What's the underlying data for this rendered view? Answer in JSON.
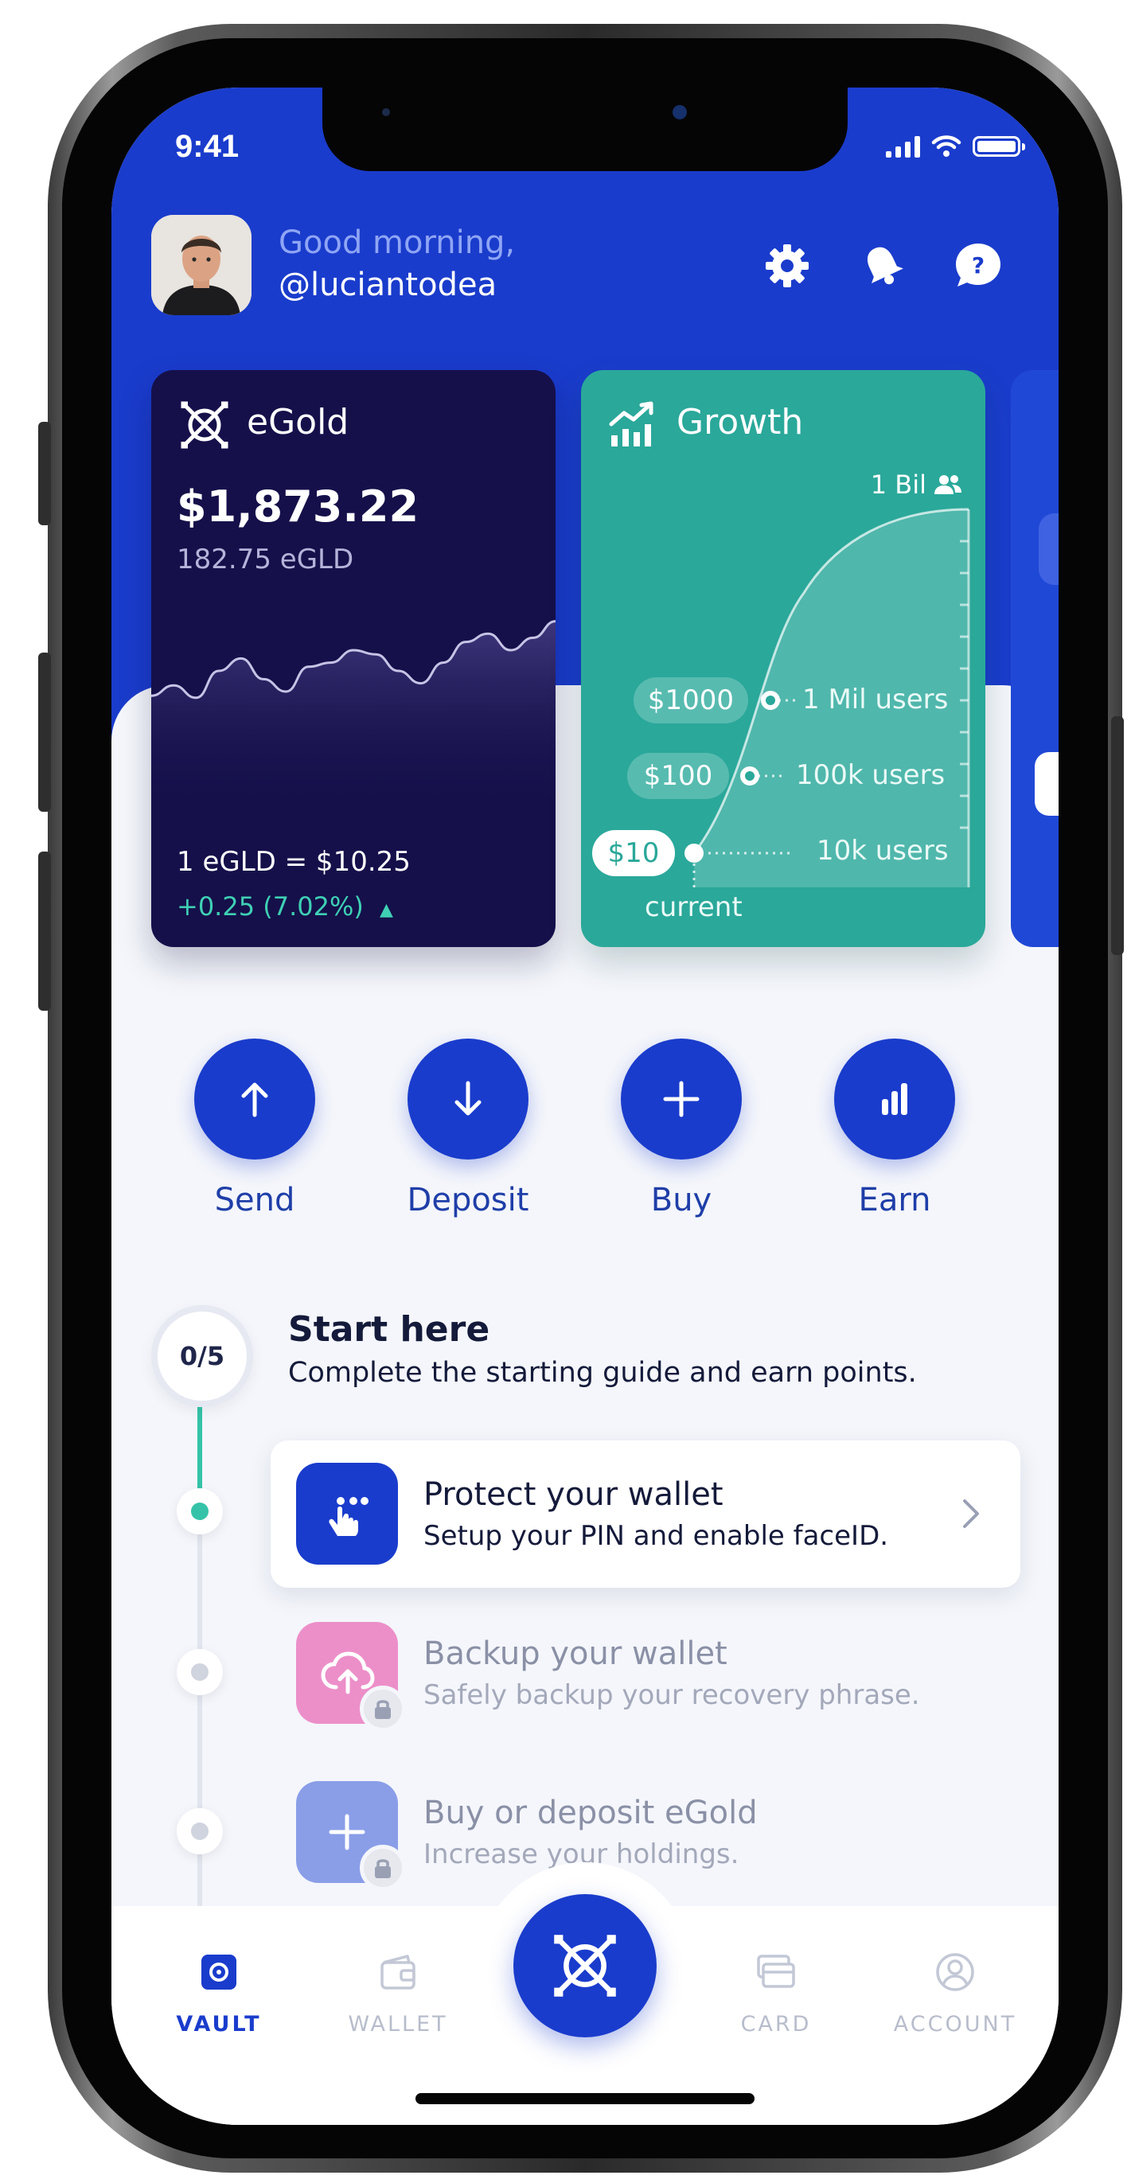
{
  "status": {
    "time": "9:41"
  },
  "header": {
    "greeting": "Good morning,",
    "username": "@luciantodea"
  },
  "cards": {
    "egold": {
      "title": "eGold",
      "amount": "$1,873.22",
      "sub": "182.75 eGLD",
      "rate": "1 eGLD = $10.25",
      "change": "+0.25 (7.02%)",
      "change_color": "#3fd0b4",
      "sparkline": [
        0.58,
        0.63,
        0.57,
        0.7,
        0.76,
        0.66,
        0.6,
        0.72,
        0.74,
        0.8,
        0.78,
        0.7,
        0.64,
        0.74,
        0.84,
        0.88,
        0.8,
        0.86,
        0.94
      ]
    },
    "growth": {
      "title": "Growth",
      "top_label": "1 Bil",
      "milestones": [
        {
          "price": "$1000",
          "users": "1 Mil users"
        },
        {
          "price": "$100",
          "users": "100k users"
        },
        {
          "price": "$10",
          "users": "10k users"
        }
      ],
      "current_label": "current"
    }
  },
  "actions": [
    {
      "label": "Send",
      "icon": "arrow-up-icon"
    },
    {
      "label": "Deposit",
      "icon": "arrow-down-icon"
    },
    {
      "label": "Buy",
      "icon": "plus-icon"
    },
    {
      "label": "Earn",
      "icon": "bar-chart-icon"
    }
  ],
  "guide": {
    "progress": "0/5",
    "title": "Start here",
    "subtitle": "Complete the starting guide and earn points.",
    "tasks": [
      {
        "title": "Protect your wallet",
        "sub": "Setup your PIN and enable faceID.",
        "locked": false
      },
      {
        "title": "Backup your wallet",
        "sub": "Safely backup your recovery phrase.",
        "locked": true
      },
      {
        "title": "Buy or deposit eGold",
        "sub": "Increase your holdings.",
        "locked": true
      }
    ]
  },
  "tabbar": {
    "items": [
      {
        "label": "VAULT",
        "active": true
      },
      {
        "label": "WALLET",
        "active": false
      },
      {
        "label": "CARD",
        "active": false
      },
      {
        "label": "ACCOUNT",
        "active": false
      }
    ]
  },
  "colors": {
    "brand_blue": "#1a3ccc",
    "egold_card": "#15104a",
    "growth_card": "#2aa89a",
    "backup_icon": "#ec8fc9",
    "buy_icon": "#8a9ee8"
  }
}
